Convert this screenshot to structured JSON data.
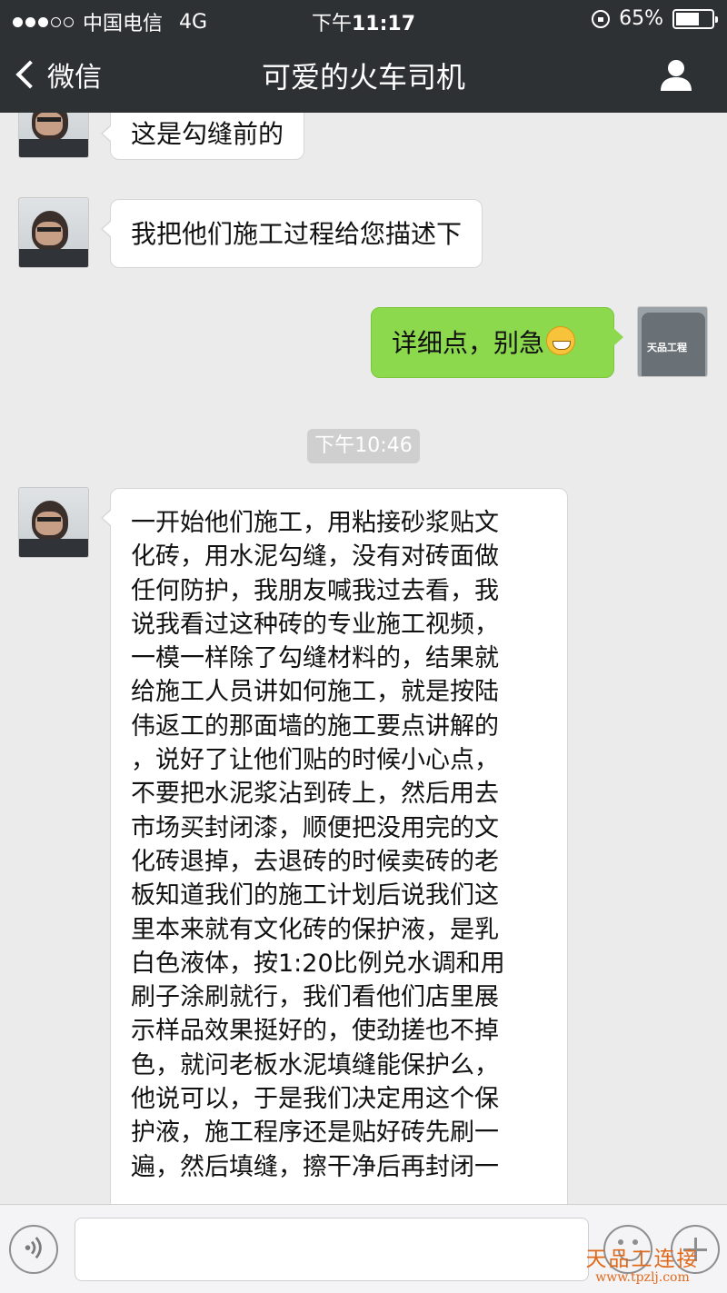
{
  "status_bar": {
    "carrier": "中国电信",
    "network": "4G",
    "time_prefix": "下午",
    "time": "11:17",
    "battery": "65%",
    "battery_level": 0.65
  },
  "nav": {
    "back_label": "微信",
    "title": "可爱的火车司机"
  },
  "messages": [
    {
      "side": "left",
      "text": "这是勾缝前的"
    },
    {
      "side": "left",
      "text": "我把他们施工过程给您描述下"
    },
    {
      "side": "right",
      "text": "详细点，别急"
    }
  ],
  "timestamp": "下午10:46",
  "long_message": "一开始他们施工，用粘接砂浆贴文\n化砖，用水泥勾缝，没有对砖面做\n任何防护，我朋友喊我过去看，我\n说我看过这种砖的专业施工视频，\n一模一样除了勾缝材料的，结果就\n给施工人员讲如何施工，就是按陆\n伟返工的那面墙的施工要点讲解的\n，说好了让他们贴的时候小心点，\n不要把水泥浆沾到砖上，然后用去\n市场买封闭漆，顺便把没用完的文\n化砖退掉，去退砖的时候卖砖的老\n板知道我们的施工计划后说我们这\n里本来就有文化砖的保护液，是乳\n白色液体，按1:20比例兑水调和用\n刷子涂刷就行，我们看他们店里展\n示样品效果挺好的，使劲搓也不掉\n色，就问老板水泥填缝能保护么，\n他说可以，于是我们决定用这个保\n护液，施工程序还是贴好砖先刷一\n遍，然后填缝，擦干净后再封闭一",
  "my_avatar_text": "天品工程",
  "watermark": {
    "line1": "天品工连接",
    "line2": "www.tpzlj.com"
  },
  "icons": [
    "signal-dots",
    "lock-rotation-icon",
    "battery-icon",
    "back-chevron-icon",
    "person-icon",
    "voice-icon",
    "emoji-icon",
    "plus-icon"
  ]
}
